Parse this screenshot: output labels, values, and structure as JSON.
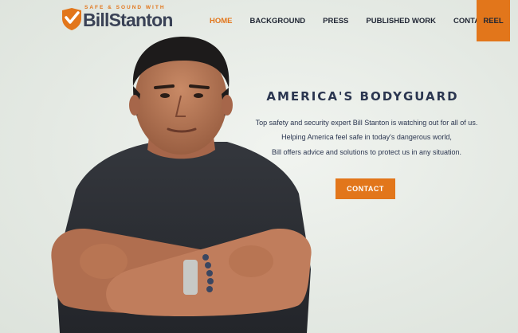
{
  "brand": {
    "tagline": "SAFE & SOUND WITH",
    "name": "BillStanton",
    "accent_color": "#e2761b",
    "text_color": "#3a4256"
  },
  "nav": {
    "items": [
      "HOME",
      "BACKGROUND",
      "PRESS",
      "PUBLISHED WORK",
      "CONTACT US"
    ],
    "active": "HOME",
    "reel_label": "REEL"
  },
  "hero": {
    "title": "AMERICA'S BODYGUARD",
    "lines": [
      "Top safety and security expert Bill Stanton is watching out for all of us.",
      "Helping America feel safe in today's dangerous world,",
      "Bill offers advice and solutions to protect us in any situation."
    ],
    "cta_label": "CONTACT"
  },
  "image": {
    "subject": "man-arms-crossed",
    "shirt_color": "#2c2e33",
    "skin_color": "#b97855"
  }
}
